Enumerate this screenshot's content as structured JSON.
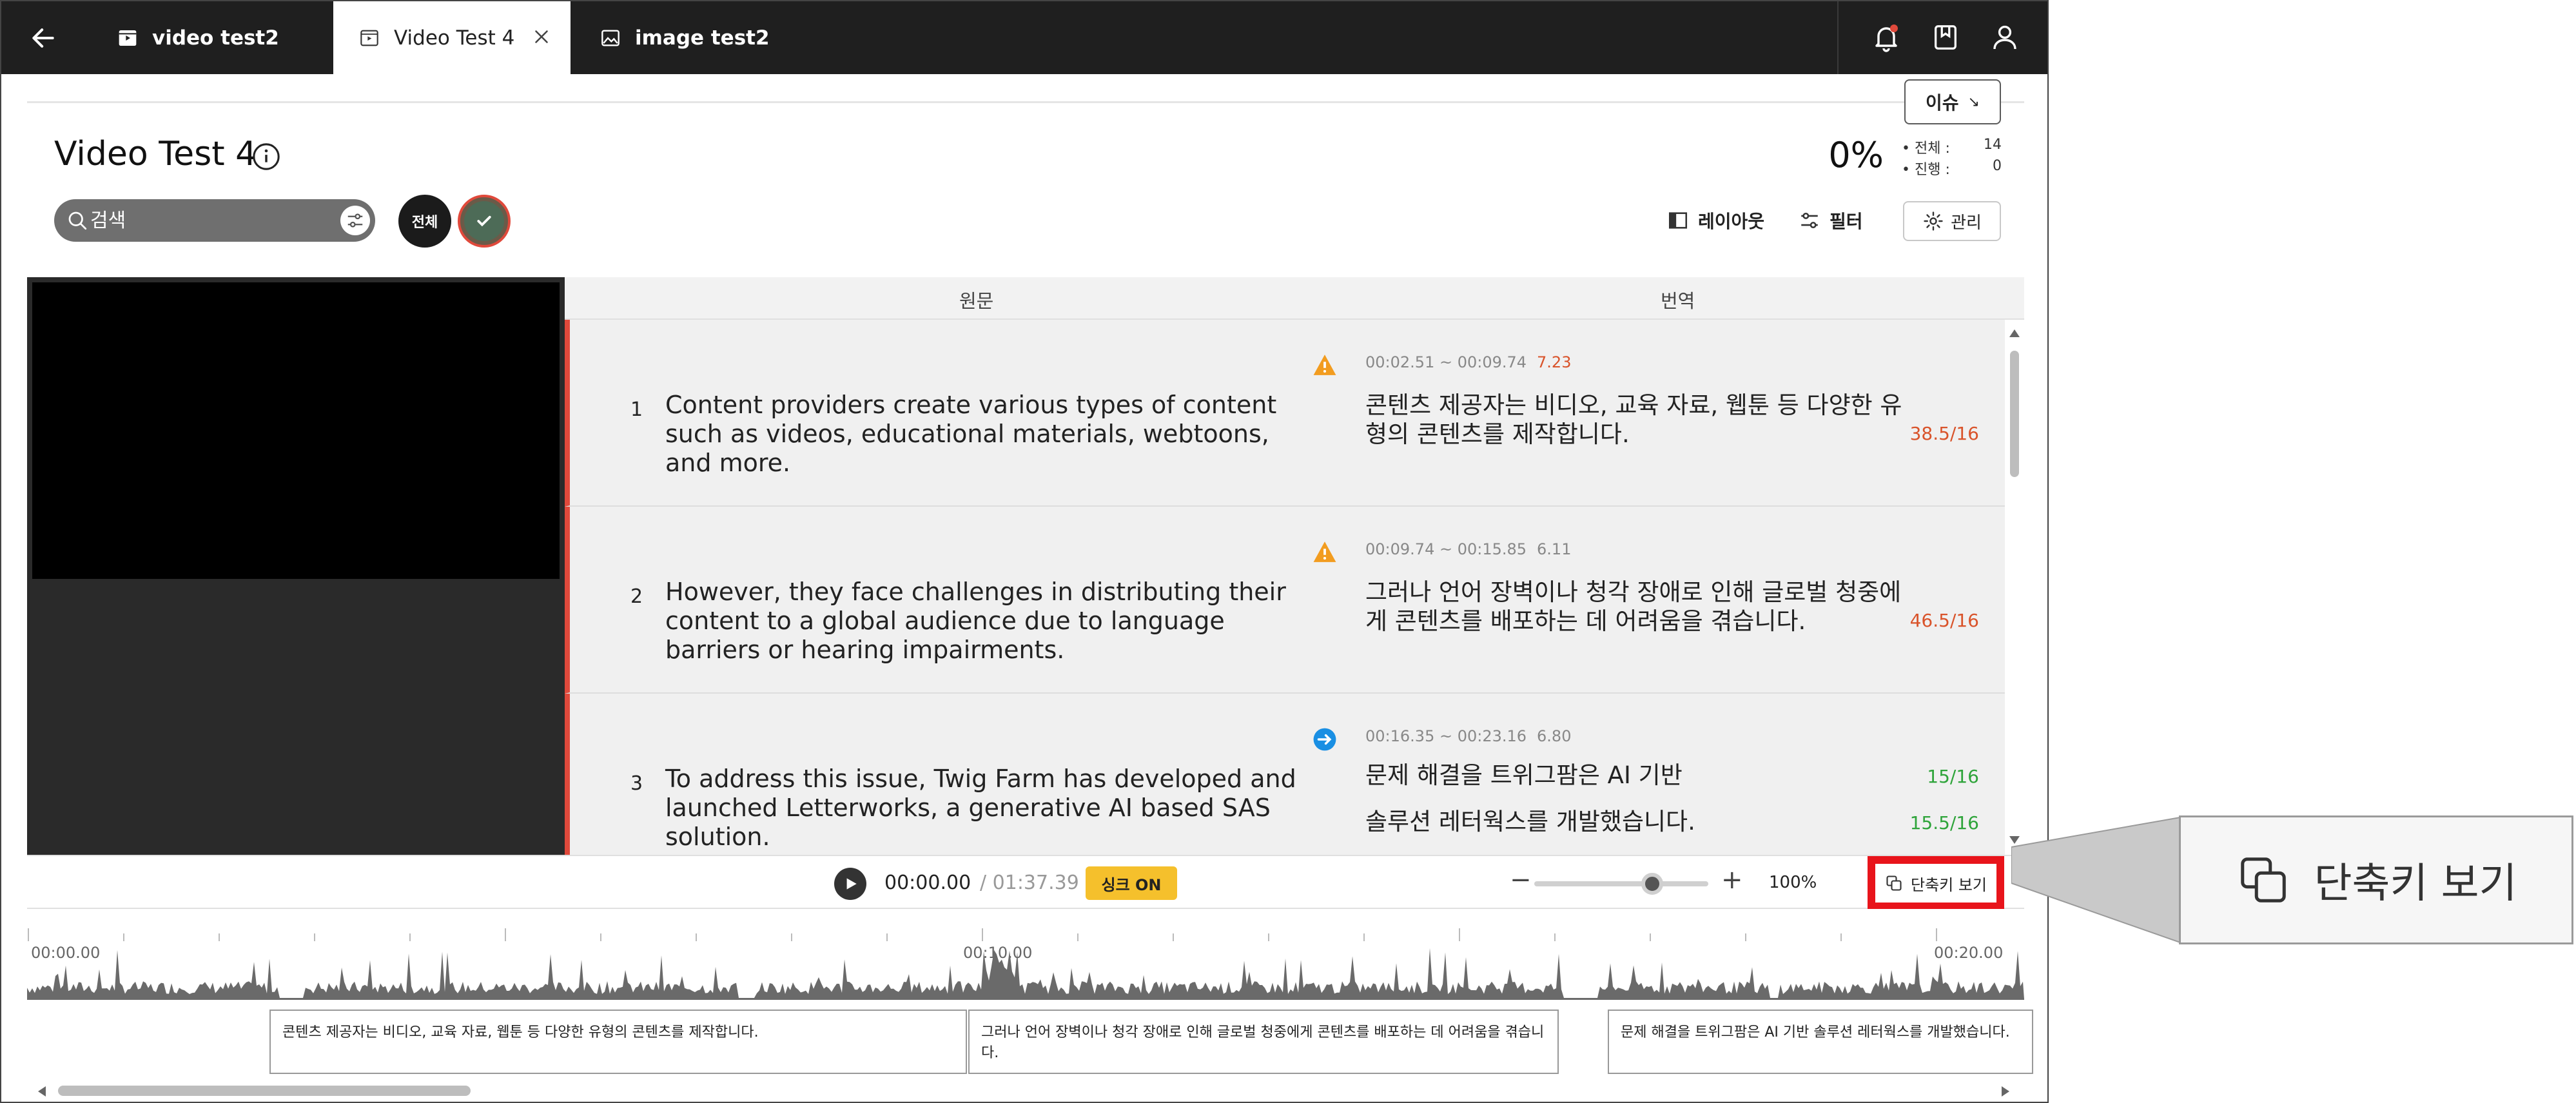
{
  "tabs": [
    {
      "label": "video test2",
      "icon": "video-icon",
      "active": false
    },
    {
      "label": "Video Test 4",
      "icon": "video-icon",
      "active": true
    },
    {
      "label": "image test2",
      "icon": "image-icon",
      "active": false
    }
  ],
  "header": {
    "title": "Video Test 4",
    "issue_label": "이슈",
    "progress": "0%",
    "stats": [
      {
        "label": "• 전체 :",
        "value": "14"
      },
      {
        "label": "• 진행 :",
        "value": "0"
      }
    ]
  },
  "toolbar": {
    "search_placeholder": "검색",
    "chip_all": "전체",
    "layout_label": "레이아웃",
    "filter_label": "필터",
    "manage_label": "관리"
  },
  "table": {
    "col_source": "원문",
    "col_translation": "번역",
    "rows": [
      {
        "num": "1",
        "source": "Content providers create various types of content such as videos, educational materials, webtoons, and more.",
        "status": "warning-icon",
        "time": "00:02.51 ~ 00:09.74",
        "duration": "7.23",
        "translation_lines": [
          {
            "text": "콘텐츠 제공자는 비디오, 교육 자료, 웹툰 등 다양한 유형의 콘텐츠를 제작합니다.",
            "count": "38.5/16"
          }
        ]
      },
      {
        "num": "2",
        "source": "However, they face challenges in distributing their content to a global audience due to language barriers or hearing impairments.",
        "status": "warning-icon",
        "time": "00:09.74 ~ 00:15.85",
        "duration": "6.11",
        "translation_lines": [
          {
            "text": "그러나 언어 장벽이나 청각 장애로 인해 글로벌 청중에게 콘텐츠를 배포하는 데 어려움을 겪습니다.",
            "count": "46.5/16"
          }
        ]
      },
      {
        "num": "3",
        "source": "To address this issue, Twig Farm has developed and launched Letterworks, a generative AI based SAS solution.",
        "status": "arrow-right-icon",
        "time": "00:16.35 ~ 00:23.16",
        "duration": "6.80",
        "translation_lines": [
          {
            "text": "문제 해결을 트위그팜은 AI 기반",
            "count": "15/16"
          },
          {
            "text": "솔루션 레터웍스를 개발했습니다.",
            "count": "15.5/16"
          }
        ]
      }
    ]
  },
  "player": {
    "current_time": "00:00.00",
    "total_time": "/ 01:37.39",
    "sync_label": "싱크 ON",
    "zoom_level": 0.2,
    "zoom_pct": "100%",
    "shortcut_label": "단축키 보기"
  },
  "timeline": {
    "ticks": [
      "00:00.00",
      "00:10.00",
      "00:20.00"
    ],
    "subtitles": [
      "콘텐츠 제공자는 비디오, 교육 자료, 웹툰 등 다양한 유형의 콘텐츠를 제작합니다.",
      "그러나 언어 장벽이나 청각 장애로 인해 글로벌 청중에게 콘텐츠를 배포하는 데 어려움을 겪습니다.",
      "문제 해결을 트위그팜은 AI 기반 솔루션 레터웍스를 개발했습니다."
    ]
  },
  "callout": {
    "label": "단축키 보기"
  },
  "colors": {
    "topbar": "#1f1f1f",
    "accent_red": "#e0493b",
    "highlight": "#e8141b",
    "sync": "#f5c02c",
    "warning": "#f29c1f",
    "info": "#1a8fe3"
  }
}
